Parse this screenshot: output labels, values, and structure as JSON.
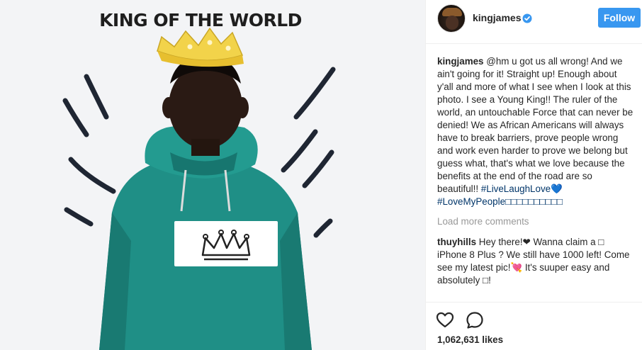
{
  "photo": {
    "title": "KING OF THE WORLD"
  },
  "post": {
    "username": "kingjames",
    "verified": true,
    "follow_label": "Follow",
    "comments": [
      {
        "author": "kingjames",
        "text": " @hm u got us all wrong! And we ain't going for it! Straight up! Enough about y'all and more of what I see when I look at this photo. I see a Young King!! The ruler of the world, an untouchable Force that can never be denied! We as African Americans will always have to break barriers, prove people wrong and work even harder to prove we belong but guess what, that's what we love because the benefits at the end of the road are so beautiful!! ",
        "tags": "#LiveLaughLove💙 #LoveMyPeople□□□□□□□□□□"
      },
      {
        "author": "thuyhills",
        "text": " Hey there!❤ Wanna claim a □ iPhone 8 Plus ? We still have 1000 left! Come see my latest pic!💘 It's suuper easy and absolutely □!"
      }
    ],
    "load_more": "Load more comments",
    "likes": "1,062,631 likes"
  },
  "colors": {
    "follow_button": "#3897f0",
    "hashtag": "#003569",
    "hoodie": "#1a8c84",
    "crown": "#f2d34a"
  },
  "icons": {
    "verified": "verified-badge-icon",
    "like": "heart-outline-icon",
    "comment": "comment-bubble-icon"
  }
}
